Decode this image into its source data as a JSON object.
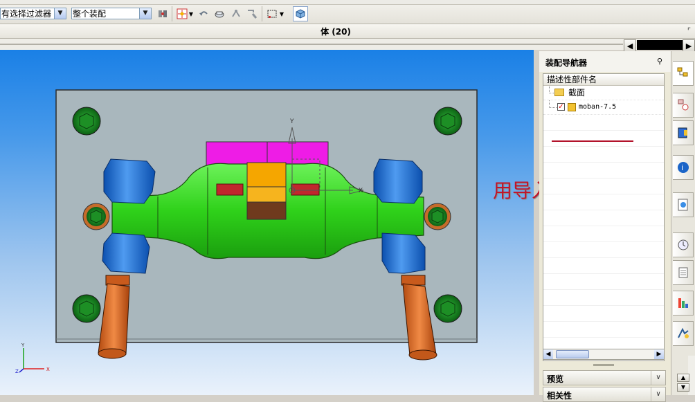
{
  "toolbar": {
    "selection_filter": "有选择过滤器",
    "assembly_scope": "整个装配",
    "icons": [
      "select-filter-icon",
      "snap-point-icon",
      "undo-arc-icon",
      "view-selection-icon",
      "rotate-icon",
      "transform-icon",
      "box-select-icon",
      "cube-render-icon"
    ]
  },
  "window": {
    "title": "体 (20)"
  },
  "viewport": {
    "annotation": "用导入parasolid",
    "triad_labels": {
      "x": "X",
      "y": "Y",
      "z": "Z"
    },
    "manipulator_labels": {
      "x": "X",
      "y": "Y"
    },
    "colors": {
      "plate": "#a9b7bd",
      "green_part": "#33e61a",
      "magenta_block": "#ee1ce6",
      "blue_cylinder": "#1e6fdb",
      "orange_rod": "#e0671f",
      "yellow_block": "#f5a600",
      "bolt_green": "#199a1f"
    }
  },
  "navigator": {
    "title": "装配导航器",
    "column_header": "描述性部件名",
    "items": [
      {
        "label": "截面",
        "type": "folder-icon"
      },
      {
        "label": "moban-7.5",
        "type": "part-icon",
        "checked": true
      }
    ]
  },
  "sections": [
    {
      "label": "预览"
    },
    {
      "label": "相关性"
    }
  ],
  "resource_bar": {
    "tabs": [
      "assembly-navigator-icon",
      "constraint-navigator-icon",
      "part-navigator-icon",
      "reuse-library-icon",
      "web-browser-icon",
      "history-icon",
      "system-materials-icon",
      "roles-icon",
      "process-studio-icon"
    ]
  }
}
